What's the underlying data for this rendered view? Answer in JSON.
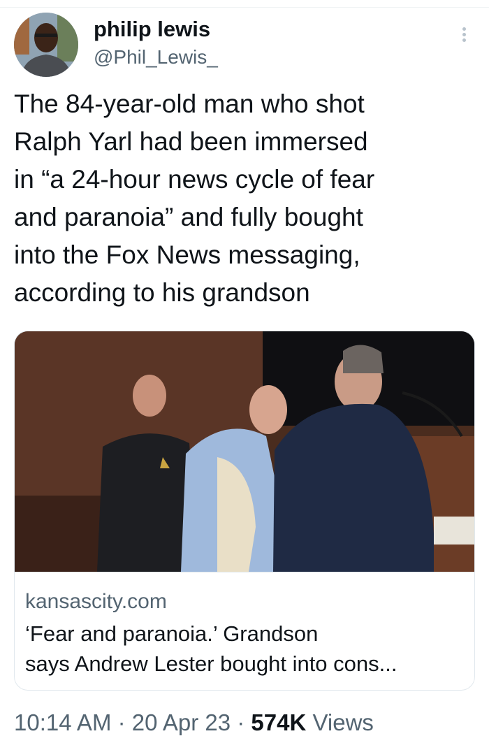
{
  "author": {
    "display_name": "philip lewis",
    "handle": "@Phil_Lewis_"
  },
  "tweet": {
    "text": "The 84-year-old man who shot\nRalph Yarl had been immersed\nin “a 24-hour news cycle of fear\nand paranoia” and fully bought\ninto the Fox News messaging,\naccording to his grandson"
  },
  "link_card": {
    "image_alt": "Courtroom photo: a sheriff's deputy, an elderly man in a light blue and cream jacket, and a man in a dark suit",
    "domain": "kansascity.com",
    "title": "‘Fear and paranoia.’ Grandson\nsays Andrew Lester bought into cons..."
  },
  "meta": {
    "time": "10:14 AM",
    "separator": "·",
    "date": "20 Apr 23",
    "views_count": "574K",
    "views_label": "Views"
  },
  "icons": {
    "more": "more-options-icon"
  },
  "colors": {
    "text_primary": "#0f1419",
    "text_secondary": "#536471",
    "border": "#e1e8ed"
  }
}
